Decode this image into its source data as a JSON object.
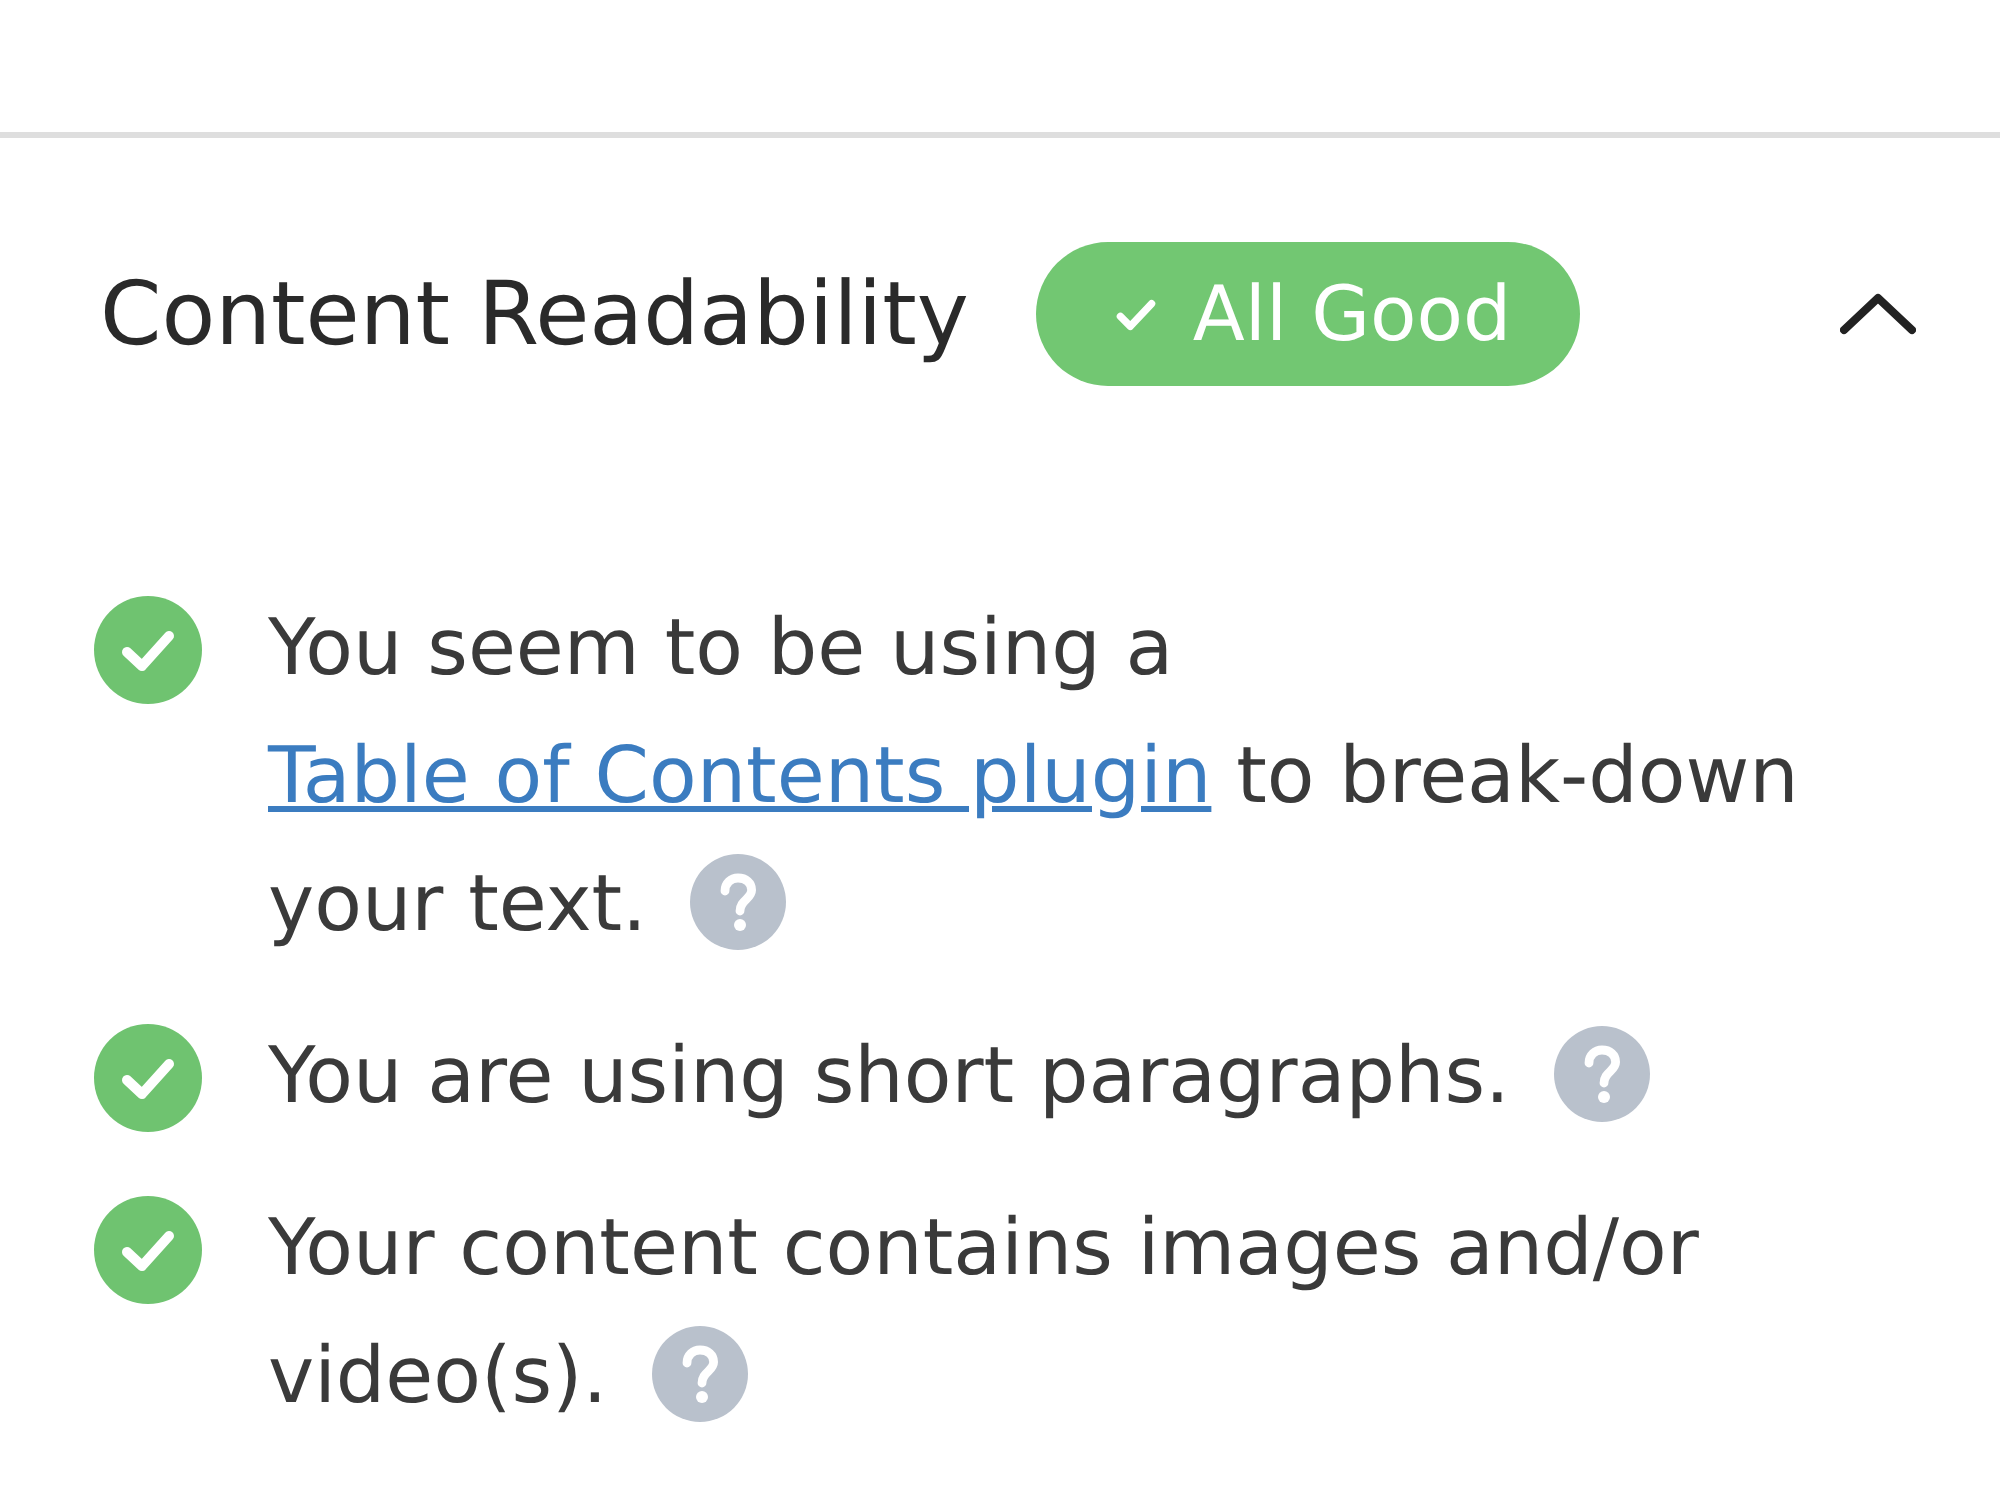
{
  "panel": {
    "title": "Content Readability",
    "status": {
      "label": "All Good",
      "ok": true
    },
    "expanded": true
  },
  "checks": [
    {
      "passed": true,
      "parts": [
        {
          "kind": "text",
          "text": "You seem to be using a "
        },
        {
          "kind": "link",
          "text": "Table of Contents plugin"
        },
        {
          "kind": "text",
          "text": " to break-down your text."
        }
      ]
    },
    {
      "passed": true,
      "parts": [
        {
          "kind": "text",
          "text": "You are using short paragraphs."
        }
      ]
    },
    {
      "passed": true,
      "parts": [
        {
          "kind": "text",
          "text": "Your content contains images and/or video(s)."
        }
      ]
    }
  ]
}
